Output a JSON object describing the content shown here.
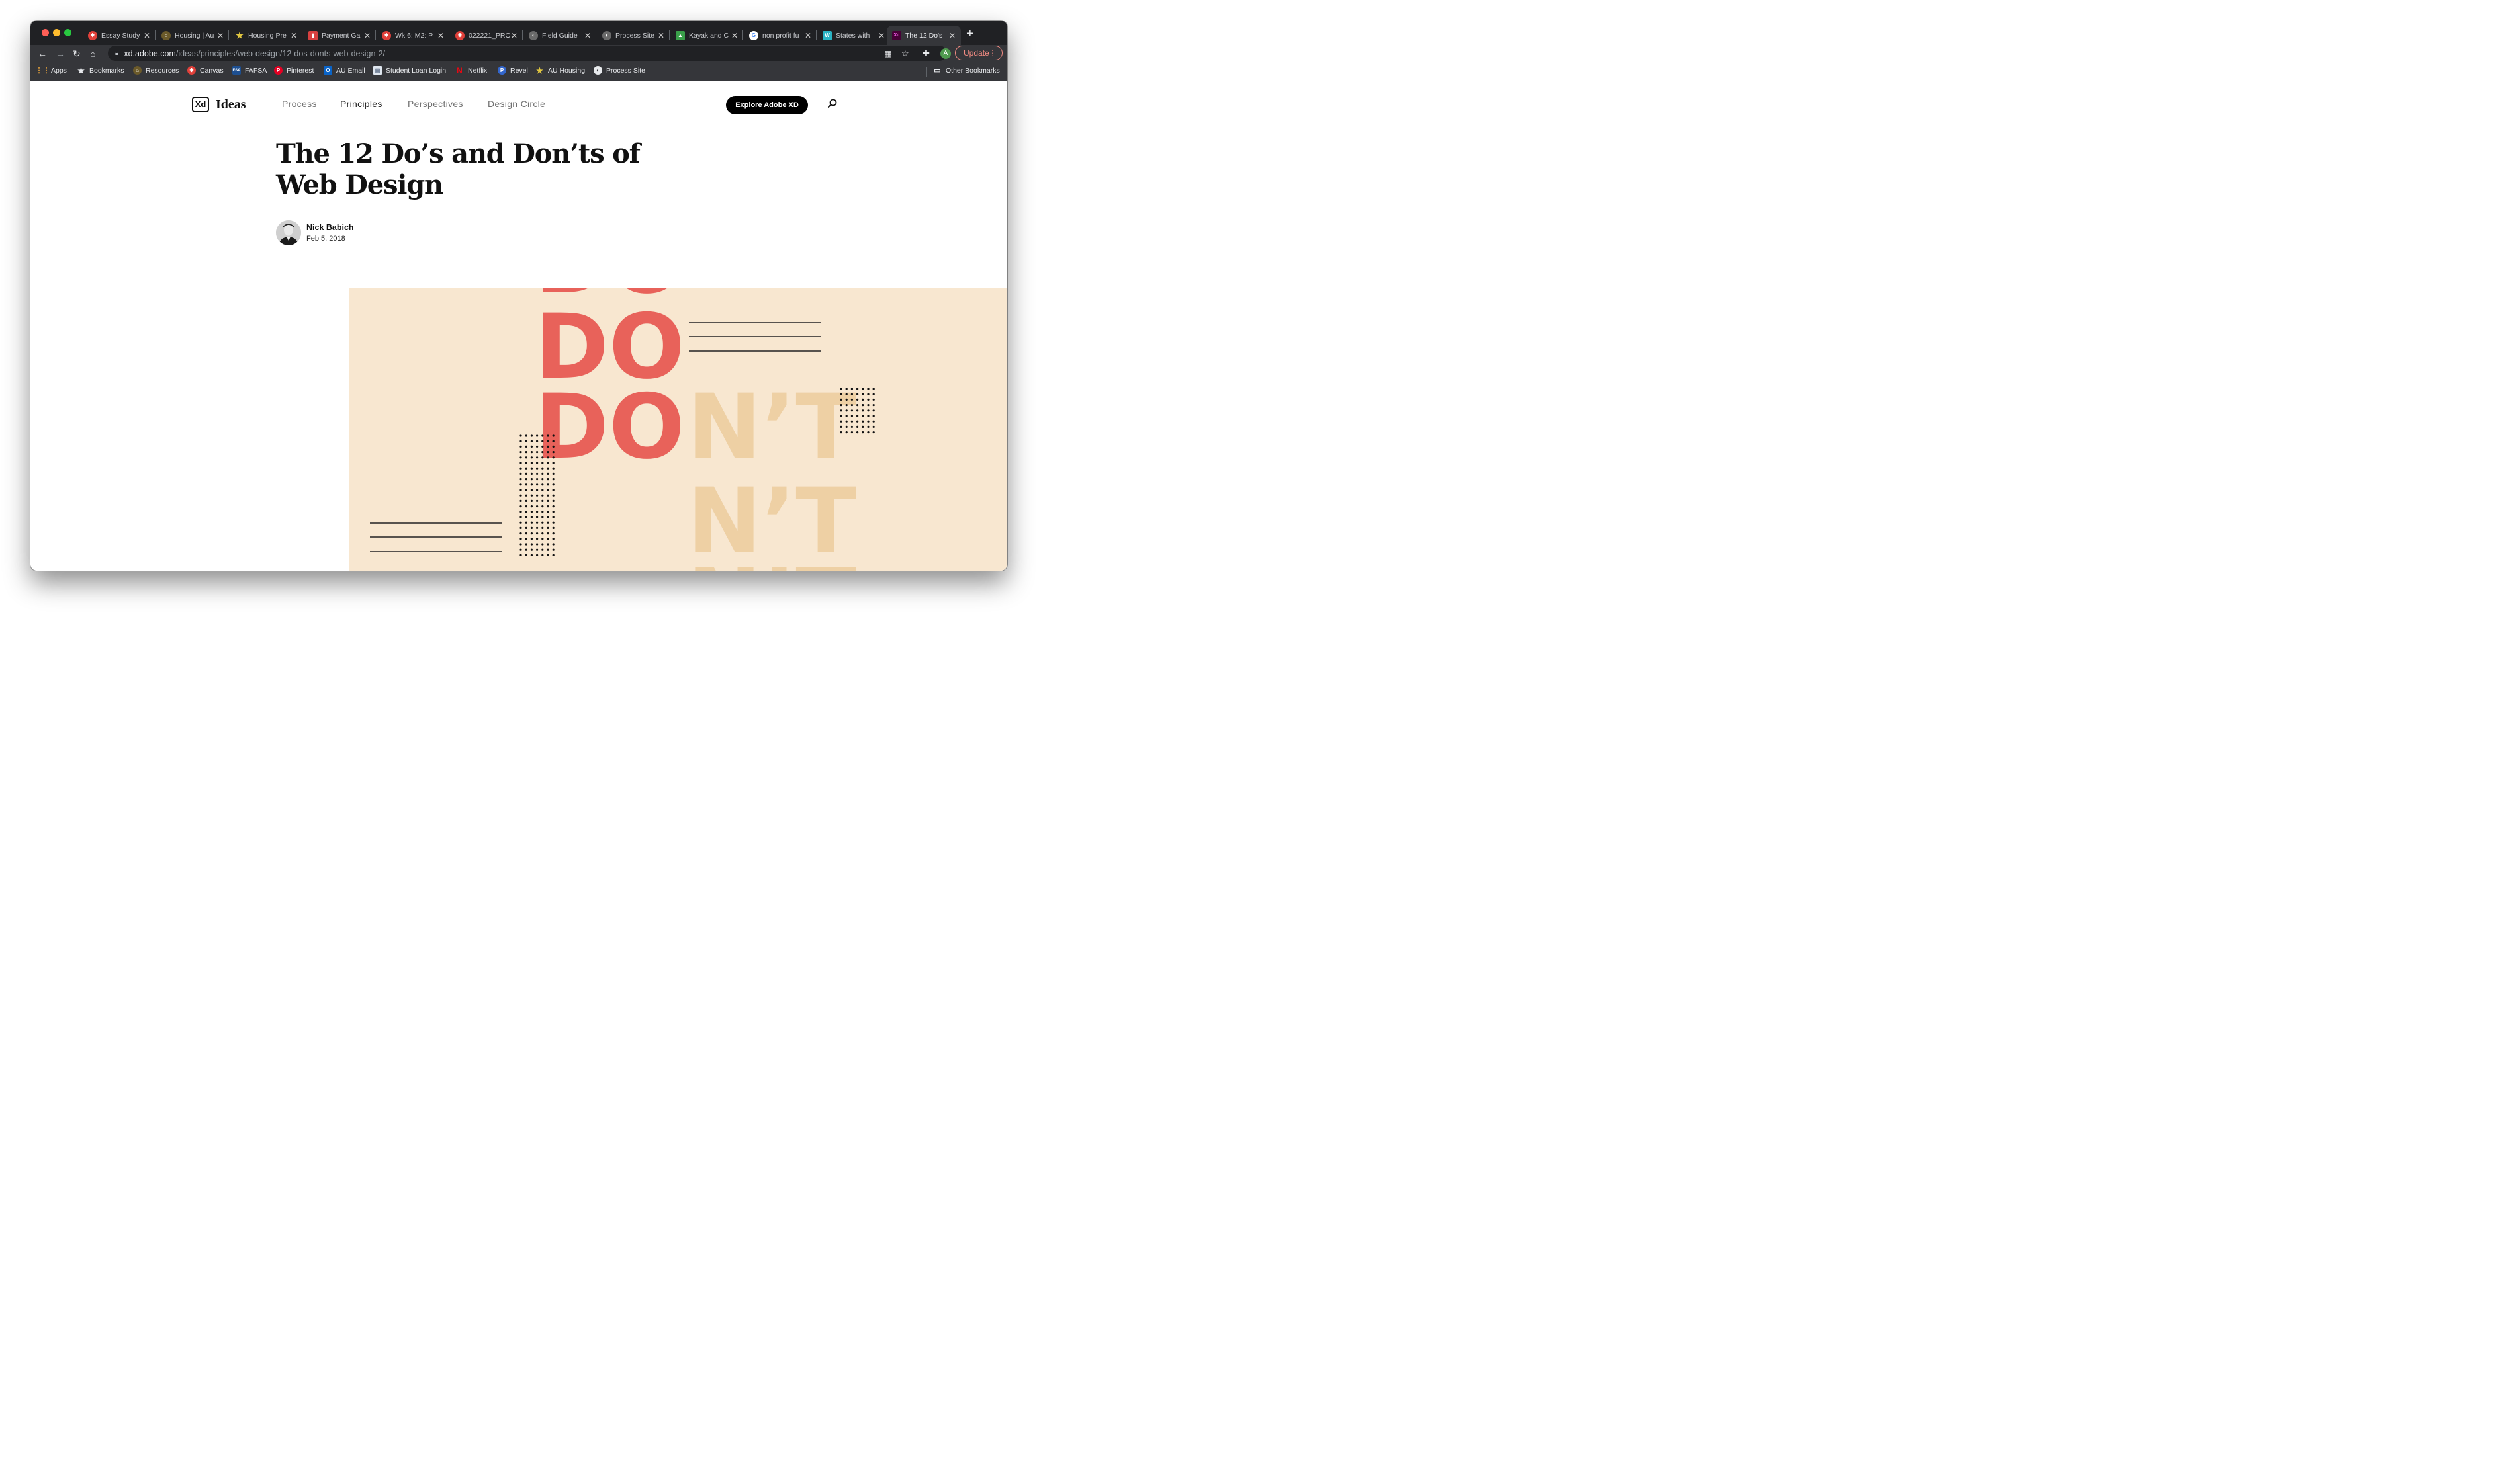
{
  "browser": {
    "tabs": [
      {
        "label": "Essay Study",
        "favicon_color": "#e0403a",
        "favicon_glyph": "✱"
      },
      {
        "label": "Housing | Au",
        "favicon_color": "#6b5a2a",
        "favicon_glyph": "⌂"
      },
      {
        "label": "Housing Pre",
        "favicon_color": "#e0c640",
        "favicon_glyph": "★"
      },
      {
        "label": "Payment Ga",
        "favicon_color": "#d64040",
        "favicon_glyph": "▮"
      },
      {
        "label": "Wk 6: M2: P",
        "favicon_color": "#e0403a",
        "favicon_glyph": "✱"
      },
      {
        "label": "022221_PRO",
        "favicon_color": "#e0403a",
        "favicon_glyph": "✱"
      },
      {
        "label": "Field Guide",
        "favicon_color": "#6a6a6a",
        "favicon_glyph": "◐"
      },
      {
        "label": "Process Site",
        "favicon_color": "#6a6a6a",
        "favicon_glyph": "◐"
      },
      {
        "label": "Kayak and C",
        "favicon_color": "#3aa04a",
        "favicon_glyph": "▲"
      },
      {
        "label": "non profit fu",
        "favicon_color": "#4285f4",
        "favicon_glyph": "G"
      },
      {
        "label": "States with",
        "favicon_color": "#2ab3c4",
        "favicon_glyph": "W"
      },
      {
        "label": "The 12 Do's",
        "favicon_color": "#470137",
        "favicon_glyph": "Xd",
        "active": true
      }
    ],
    "new_tab": "+",
    "url_host": "xd.adobe.com",
    "url_path": "/ideas/principles/web-design/12-dos-donts-web-design-2/",
    "profile_initial": "A",
    "update_label": "Update",
    "bookmarks": [
      {
        "label": "Apps",
        "icon_color": "#e8eaed",
        "icon": "apps-grid-icon"
      },
      {
        "label": "Bookmarks",
        "icon_color": "#e8eaed",
        "icon": "star-icon"
      },
      {
        "label": "Resources",
        "icon_color": "#6b5a2a",
        "icon": "house-icon"
      },
      {
        "label": "Canvas",
        "icon_color": "#e0403a",
        "icon": "canvas-icon"
      },
      {
        "label": "FAFSA",
        "icon_color": "#1d4f91",
        "icon": "fafsa-icon"
      },
      {
        "label": "Pinterest",
        "icon_color": "#e60023",
        "icon": "pinterest-icon"
      },
      {
        "label": "AU Email",
        "icon_color": "#0a64c8",
        "icon": "outlook-icon"
      },
      {
        "label": "Student Loan Login",
        "icon_color": "#dfe6ef",
        "icon": "document-icon"
      },
      {
        "label": "Netflix",
        "icon_color": "#e50914",
        "icon": "netflix-icon"
      },
      {
        "label": "Revel",
        "icon_color": "#3366cc",
        "icon": "revel-icon"
      },
      {
        "label": "AU Housing",
        "icon_color": "#e0c640",
        "icon": "star-icon"
      },
      {
        "label": "Process Site",
        "icon_color": "#e8eaed",
        "icon": "globe-icon"
      }
    ],
    "other_bookmarks": "Other Bookmarks"
  },
  "site": {
    "logo_mark": "Xd",
    "logo_text": "Ideas",
    "nav": [
      "Process",
      "Principles",
      "Perspectives",
      "Design Circle"
    ],
    "active_nav": "Principles",
    "cta": "Explore Adobe XD"
  },
  "article": {
    "title": "The 12 Do’s and Don’ts of Web Design",
    "author": "Nick Babich",
    "date": "Feb 5, 2018"
  },
  "hero": {
    "background": "#f8e7d0",
    "do_color": "#e8625a",
    "dont_color": "#eed0a4",
    "do_word": "DO",
    "dont_word": "DON’T",
    "n_word": "N’T"
  }
}
